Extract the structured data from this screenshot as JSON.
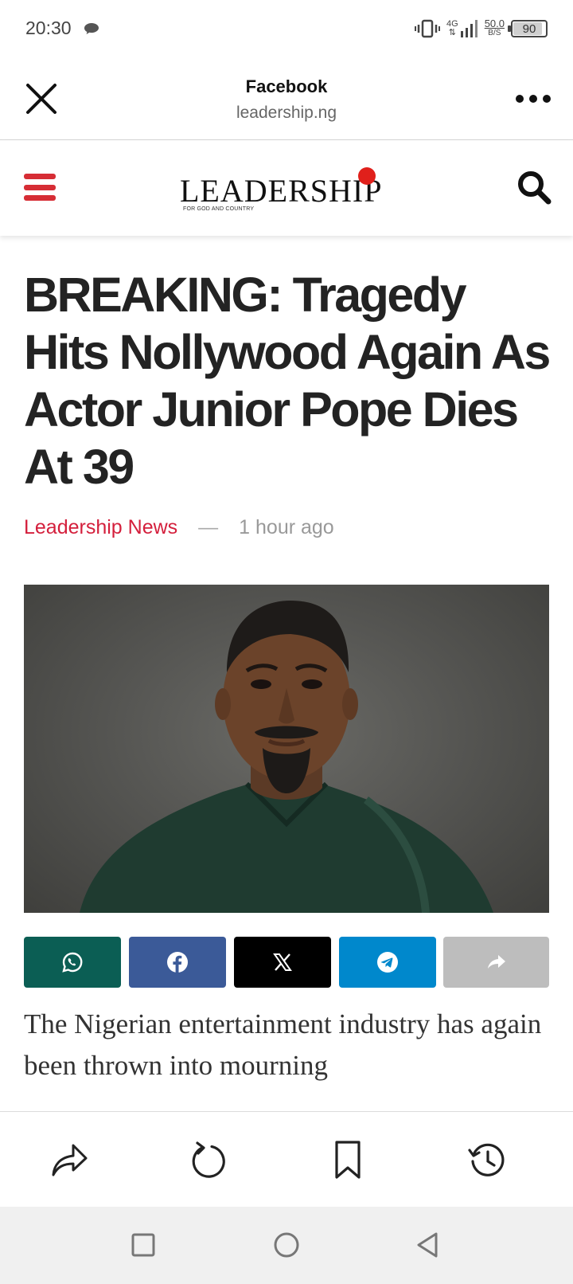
{
  "status_bar": {
    "time": "20:30",
    "network": "4G",
    "speed_value": "50.0",
    "speed_unit": "B/S",
    "battery": "90",
    "battery_level": 0.9
  },
  "browser": {
    "title": "Facebook",
    "url": "leadership.ng",
    "close_icon": "close-icon",
    "more_icon": "more-options-icon"
  },
  "site": {
    "logo_text": "LEADERSHIP",
    "logo_tagline": "FOR GOD AND COUNTRY",
    "logo_dot_color": "#e0201b",
    "accent_color": "#d62d35"
  },
  "article": {
    "headline": "BREAKING: Tragedy Hits Nollywood Again As Actor Junior Pope Dies At 39",
    "author": "Leadership News",
    "separator": "—",
    "time_ago": "1 hour ago",
    "body_preview": "The Nigerian entertainment industry has again been thrown into mourning"
  },
  "share_buttons": [
    {
      "name": "whatsapp",
      "icon": "whatsapp-icon",
      "color": "#0b5e54"
    },
    {
      "name": "facebook",
      "icon": "facebook-icon",
      "color": "#3b5a98"
    },
    {
      "name": "x",
      "icon": "x-icon",
      "color": "#000000"
    },
    {
      "name": "telegram",
      "icon": "telegram-icon",
      "color": "#0088cc"
    },
    {
      "name": "more-share",
      "icon": "share-arrow-icon",
      "color": "#bdbdbd"
    }
  ],
  "bottom_toolbar": [
    "share-icon",
    "refresh-icon",
    "bookmark-icon",
    "history-icon"
  ],
  "nav_bar": [
    "recents-icon",
    "home-icon",
    "back-icon"
  ]
}
